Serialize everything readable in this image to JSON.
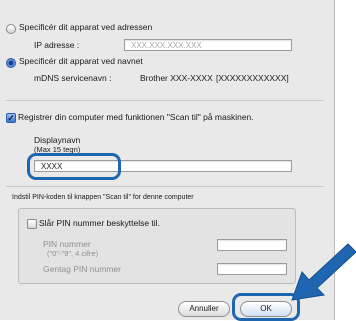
{
  "address_option": {
    "label": "Specificér dit apparat ved adressen",
    "ip_label": "IP adresse :",
    "ip_placeholder": "XXX.XXX.XXX.XXX"
  },
  "name_option": {
    "label": "Specificér dit apparat ved navnet",
    "mdns_label": "mDNS servicenavn :",
    "mdns_value": "Brother XXX-XXXX",
    "mdns_bracket": "[XXXXXXXXXXXX]"
  },
  "register": {
    "checkbox_label": "Registrer din computer med funktionen \"Scan til\" på maskinen.",
    "display_name_label": "Displaynavn",
    "display_name_hint": "(Max 15 tegn)",
    "display_name_value": "XXXX"
  },
  "pin": {
    "section_label": "Indstil PIN-koden til knappen \"Scan til\" for denne computer",
    "checkbox_label": "Slår PIN nummer beskyttelse til.",
    "pin_label": "PIN nummer",
    "pin_hint": "(\"0\"-\"9\", 4 cifre)",
    "repeat_label": "Gentag PIN nummer"
  },
  "buttons": {
    "cancel": "Annuller",
    "ok": "OK"
  },
  "colors": {
    "callout": "#1e67b0",
    "arrow": "#1e67b0"
  }
}
